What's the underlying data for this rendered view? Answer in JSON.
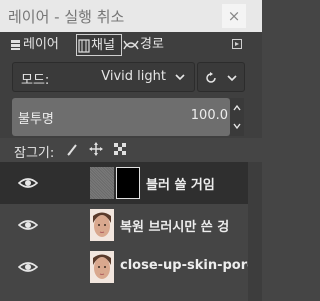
{
  "window": {
    "title": "레이어 - 실행 취소",
    "close_glyph": "×"
  },
  "tabs": [
    {
      "label": "레이어",
      "icon": "layers-icon",
      "active": false
    },
    {
      "label": "채널",
      "icon": "channels-icon",
      "active": true
    },
    {
      "label": "경로",
      "icon": "paths-icon",
      "active": false
    }
  ],
  "mode": {
    "label": "모드:",
    "value": "Vivid light"
  },
  "opacity": {
    "label": "불투명",
    "value": "100.0"
  },
  "lock": {
    "label": "잠그기:",
    "icons": [
      "lock-pixels-icon",
      "lock-position-icon",
      "lock-alpha-icon"
    ]
  },
  "layers": [
    {
      "name": "블러 쓸 거임",
      "visible": true,
      "selected": true,
      "has_mask": true,
      "thumb": "gray-noise"
    },
    {
      "name": "복원 브러시만 쓴 겅",
      "visible": true,
      "selected": false,
      "has_mask": false,
      "thumb": "portrait"
    },
    {
      "name": "close-up-skin-pore",
      "visible": true,
      "selected": false,
      "has_mask": false,
      "thumb": "portrait"
    }
  ]
}
